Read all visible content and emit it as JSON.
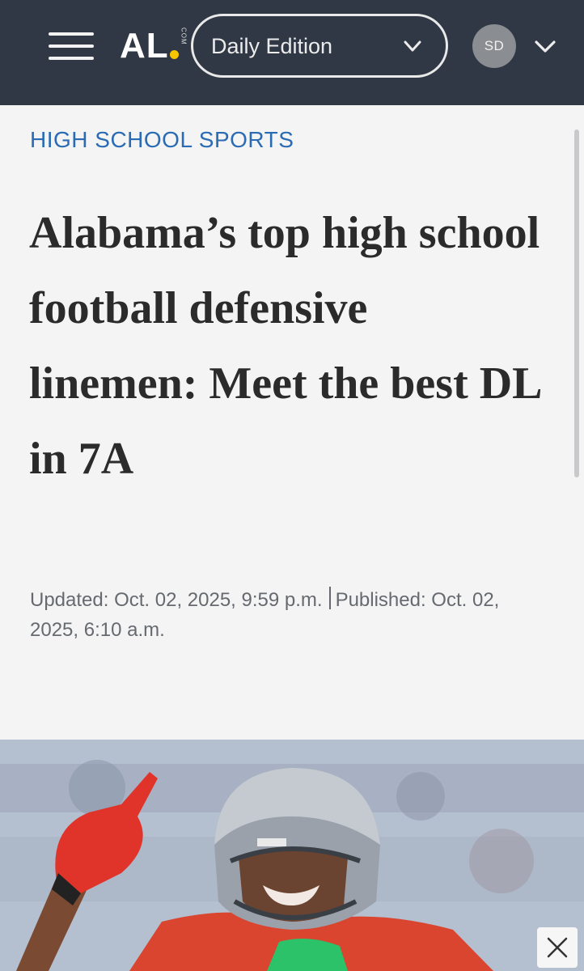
{
  "header": {
    "logo_text": "AL",
    "logo_suffix": "COM",
    "edition_label": "Daily Edition",
    "avatar_initials": "SD"
  },
  "article": {
    "section": "HIGH SCHOOL SPORTS",
    "headline": "Alabama’s top high school football defensive linemen: Meet the best DL in 7A",
    "updated": "Updated: Oct. 02, 2025, 9:59 p.m.",
    "published": "Published: Oct. 02, 2025, 6:10 a.m."
  },
  "hero_image": {
    "description_icon": "football-player-photo"
  },
  "colors": {
    "header_bg": "#2f3844",
    "section_blue": "#2a6bb3",
    "logo_dot": "#f7c600",
    "page_bg": "#f4f4f5"
  }
}
